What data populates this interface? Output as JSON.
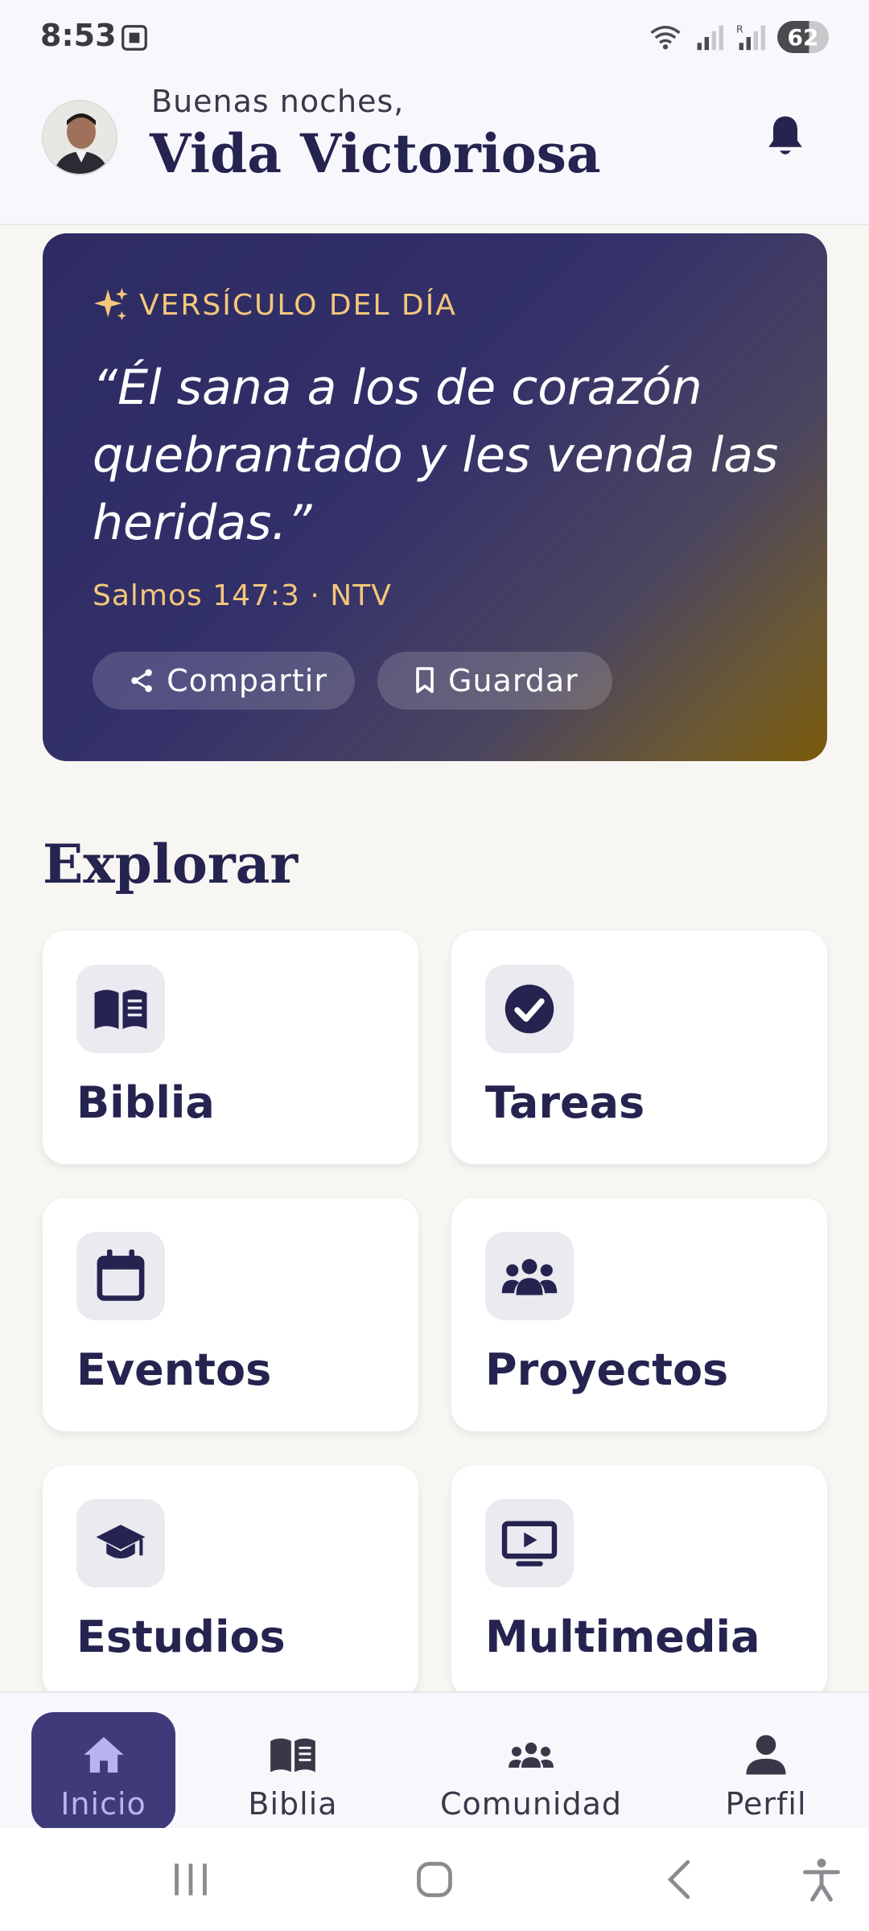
{
  "status_bar": {
    "time": "8:53",
    "battery": "62"
  },
  "header": {
    "greeting": "Buenas noches,",
    "title": "Vida Victoriosa"
  },
  "verse": {
    "label": "VERSÍCULO DEL DÍA",
    "text": "“Él sana a los de corazón quebrantado y les venda las heridas.”",
    "reference": "Salmos 147:3 · NTV",
    "share_label": "Compartir",
    "save_label": "Guardar"
  },
  "explore": {
    "title": "Explorar",
    "tiles": [
      {
        "label": "Biblia",
        "icon": "book-open-icon"
      },
      {
        "label": "Tareas",
        "icon": "check-circle-icon"
      },
      {
        "label": "Eventos",
        "icon": "calendar-icon"
      },
      {
        "label": "Proyectos",
        "icon": "group-icon"
      },
      {
        "label": "Estudios",
        "icon": "graduation-cap-icon"
      },
      {
        "label": "Multimedia",
        "icon": "play-screen-icon"
      }
    ]
  },
  "bottom_nav": {
    "items": [
      {
        "label": "Inicio",
        "icon": "home-icon",
        "active": true
      },
      {
        "label": "Biblia",
        "icon": "book-open-icon",
        "active": false
      },
      {
        "label": "Comunidad",
        "icon": "community-icon",
        "active": false
      },
      {
        "label": "Perfil",
        "icon": "person-icon",
        "active": false
      }
    ]
  },
  "colors": {
    "primary": "#25234f",
    "accent_gold": "#f4c77c",
    "active_nav": "#3f3b7a"
  }
}
